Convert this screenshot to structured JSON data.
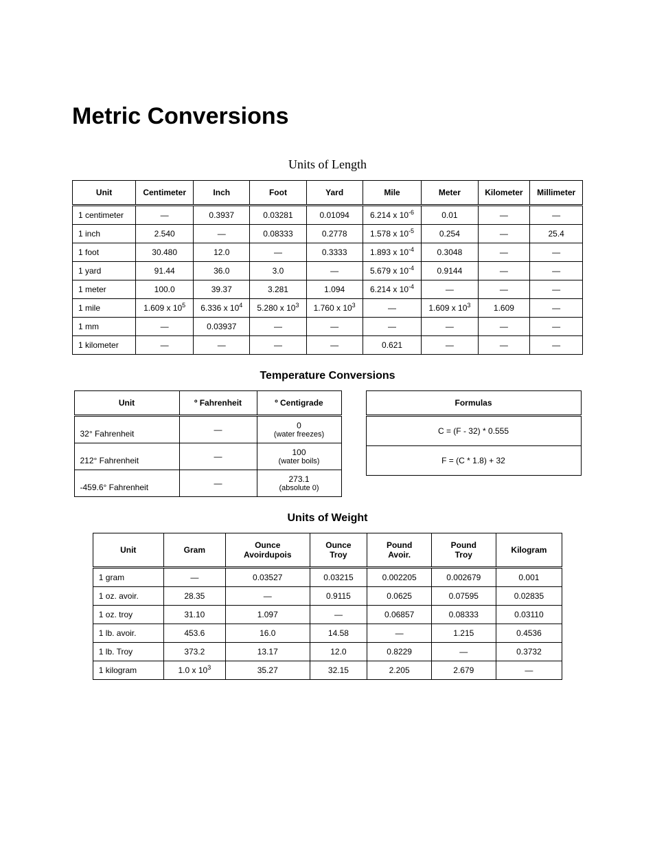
{
  "title": "Metric Conversions",
  "length": {
    "caption": "Units of Length",
    "headers": [
      "Unit",
      "Centimeter",
      "Inch",
      "Foot",
      "Yard",
      "Mile",
      "Meter",
      "Kilometer",
      "Millimeter"
    ],
    "rows": [
      {
        "unit": "1 centimeter",
        "cells": [
          "—",
          "0.3937",
          "0.03281",
          "0.01094",
          {
            "sci": "6.214 x 10",
            "exp": "-6"
          },
          "0.01",
          "—",
          "—"
        ]
      },
      {
        "unit": "1 inch",
        "cells": [
          "2.540",
          "—",
          "0.08333",
          "0.2778",
          {
            "sci": "1.578 x 10",
            "exp": "-5"
          },
          "0.254",
          "—",
          "25.4"
        ]
      },
      {
        "unit": "1 foot",
        "cells": [
          "30.480",
          "12.0",
          "—",
          "0.3333",
          {
            "sci": "1.893 x 10",
            "exp": "-4"
          },
          "0.3048",
          "—",
          "—"
        ]
      },
      {
        "unit": "1 yard",
        "cells": [
          "91.44",
          "36.0",
          "3.0",
          "—",
          {
            "sci": "5.679 x 10",
            "exp": "-4"
          },
          "0.9144",
          "—",
          "—"
        ]
      },
      {
        "unit": "1 meter",
        "cells": [
          "100.0",
          "39.37",
          "3.281",
          "1.094",
          {
            "sci": "6.214 x 10",
            "exp": "-4"
          },
          "—",
          "—",
          "—"
        ]
      },
      {
        "unit": "1 mile",
        "cells": [
          {
            "sci": "1.609 x 10",
            "exp": "5"
          },
          {
            "sci": "6.336 x 10",
            "exp": "4"
          },
          {
            "sci": "5.280 x 10",
            "exp": "3"
          },
          {
            "sci": "1.760 x 10",
            "exp": "3"
          },
          "—",
          {
            "sci": "1.609 x 10",
            "exp": "3"
          },
          "1.609",
          "—"
        ]
      },
      {
        "unit": "1 mm",
        "cells": [
          "—",
          "0.03937",
          "—",
          "—",
          "—",
          "—",
          "—",
          "—"
        ]
      },
      {
        "unit": "1 kilometer",
        "cells": [
          "—",
          "—",
          "—",
          "—",
          "0.621",
          "—",
          "—",
          "—"
        ]
      }
    ]
  },
  "temperature": {
    "caption": "Temperature Conversions",
    "headers_unit": "Unit",
    "headers_f": "Fahrenheit",
    "headers_c": "Centigrade",
    "rows": [
      {
        "unit": "32° Fahrenheit",
        "f": "—",
        "c": "0",
        "note": "(water freezes)"
      },
      {
        "unit": "212° Fahrenheit",
        "f": "—",
        "c": "100",
        "note": "(water boils)"
      },
      {
        "unit": "-459.6° Fahrenheit",
        "f": "—",
        "c": "273.1",
        "note": "(absolute 0)"
      }
    ],
    "formulas_header": "Formulas",
    "formulas": [
      "C = (F - 32) * 0.555",
      "F = (C * 1.8) + 32"
    ]
  },
  "weight": {
    "caption": "Units of Weight",
    "headers": [
      "Unit",
      "Gram",
      "Ounce Avoirdupois",
      "Ounce Troy",
      "Pound Avoir.",
      "Pound Troy",
      "Kilogram"
    ],
    "rows": [
      {
        "unit": "1 gram",
        "cells": [
          "—",
          "0.03527",
          "0.03215",
          "0.002205",
          "0.002679",
          "0.001"
        ]
      },
      {
        "unit": "1 oz. avoir.",
        "cells": [
          "28.35",
          "—",
          "0.9115",
          "0.0625",
          "0.07595",
          "0.02835"
        ]
      },
      {
        "unit": "1 oz. troy",
        "cells": [
          "31.10",
          "1.097",
          "—",
          "0.06857",
          "0.08333",
          "0.03110"
        ]
      },
      {
        "unit": "1 lb. avoir.",
        "cells": [
          "453.6",
          "16.0",
          "14.58",
          "—",
          "1.215",
          "0.4536"
        ]
      },
      {
        "unit": "1 lb. Troy",
        "cells": [
          "373.2",
          "13.17",
          "12.0",
          "0.8229",
          "—",
          "0.3732"
        ]
      },
      {
        "unit": "1 kilogram",
        "cells": [
          {
            "sci": "1.0 x 10",
            "exp": "3"
          },
          "35.27",
          "32.15",
          "2.205",
          "2.679",
          "—"
        ]
      }
    ]
  }
}
